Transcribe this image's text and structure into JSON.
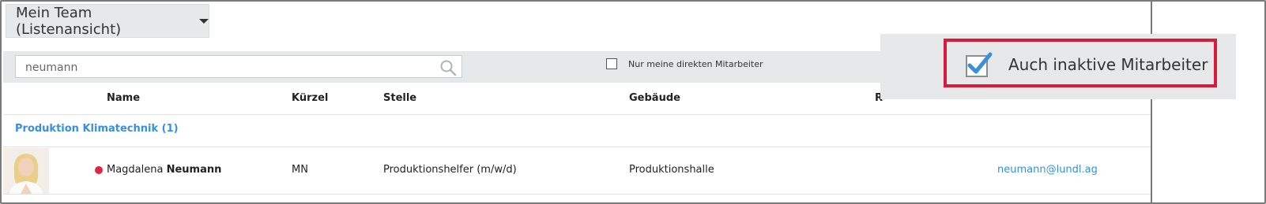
{
  "view": {
    "dropdown_label": "Mein Team (Listenansicht)"
  },
  "filters": {
    "search_value": "neumann",
    "direct_reports_label": "Nur meine direkten Mitarbeiter",
    "direct_reports_checked": false
  },
  "table": {
    "columns": [
      "Name",
      "Kürzel",
      "Stelle",
      "Gebäude",
      "R"
    ],
    "groups": [
      {
        "label": "Produktion Klimatechnik (1)",
        "rows": [
          {
            "status_color": "#e0263e",
            "first_name": "Magdalena",
            "last_name": "Neumann",
            "kuerzel": "MN",
            "stelle": "Produktionshelfer (m/w/d)",
            "gebaeude": "Produktionshalle",
            "email": "neumann@lundl.ag"
          }
        ]
      }
    ]
  },
  "zoom_callout": {
    "label": "Auch inaktive Mitarbeiter",
    "checked": true,
    "highlight_color": "#d91a3a"
  }
}
